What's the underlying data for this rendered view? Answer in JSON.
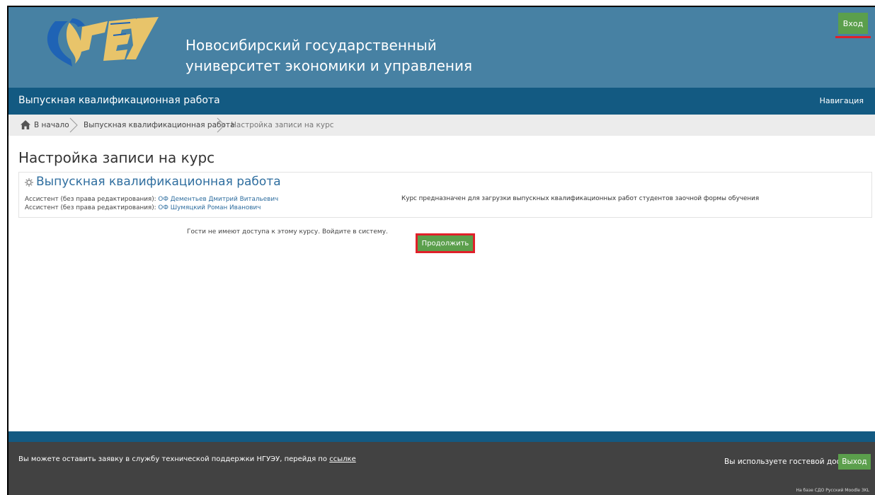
{
  "header": {
    "university_name_line1": "Новосибирский государственный",
    "university_name_line2": "университет экономики и управления",
    "login_label": "Вход"
  },
  "navbar": {
    "site_name": "Выпускная квалификационная работа",
    "navigation_label": "Навигация"
  },
  "breadcrumb": {
    "home": "В начало",
    "course": "Выпускная квалификационная работа",
    "current": "Настройка записи на курс"
  },
  "main": {
    "page_title": "Настройка записи на курс",
    "course": {
      "name": "Выпускная квалификационная работа",
      "teachers": [
        {
          "role": "Ассистент (без права редактирования):",
          "name": "ОФ Дементьев Дмитрий Витальевич"
        },
        {
          "role": "Ассистент (без права редактирования):",
          "name": "ОФ Шумяцкий Роман Иванович"
        }
      ],
      "summary": "Курс предназначен для загрузки выпускных квалификационных работ студентов заочной формы обучения"
    },
    "guest_notice": "Гости не имеют доступа к этому курсу. Войдите в систему.",
    "continue_label": "Продолжить"
  },
  "footer": {
    "support_text": "Вы можете оставить заявку в службу технической поддержки НГУЭУ, перейдя по",
    "support_link": "ссылке",
    "guest_access_text": "Вы используете гостевой доступ",
    "logout_label": "Выход",
    "powered_by": "На базе СДО Русский Moodle 3KL"
  },
  "colors": {
    "header_bg": "#4781a3",
    "navbar_bg": "#135a82",
    "breadcrumb_bg": "#ececec",
    "button_green": "#5b9f4c",
    "highlight_red": "#e0202a",
    "footer_bg": "#424242",
    "link_blue": "#2f6e9f"
  },
  "icons": {
    "breadcrumb_home": "home-icon",
    "breadcrumb_separator": "chevron-right-icon",
    "course_category": "course-icon"
  }
}
